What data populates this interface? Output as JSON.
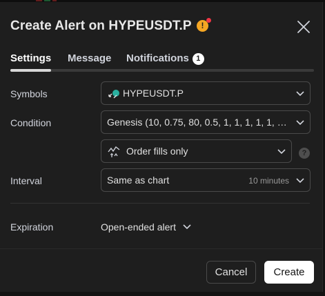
{
  "dialog": {
    "title": "Create Alert on HYPEUSDT.P",
    "warning_icon": "!"
  },
  "tabs": [
    {
      "label": "Settings",
      "active": true
    },
    {
      "label": "Message",
      "active": false
    },
    {
      "label": "Notifications",
      "active": false,
      "badge": "1"
    }
  ],
  "form": {
    "symbols": {
      "label": "Symbols",
      "value": "HYPEUSDT.P",
      "icon": "alert-symbol-icon"
    },
    "condition": {
      "label": "Condition",
      "value": "Genesis (10, 0.75, 80, 0.5, 1, 1, 1, 1, 1, …"
    },
    "trigger": {
      "value": "Order fills only",
      "icon": "order-fills-icon",
      "help": "?"
    },
    "interval": {
      "label": "Interval",
      "value": "Same as chart",
      "hint": "10 minutes"
    },
    "expiration": {
      "label": "Expiration",
      "value": "Open-ended alert"
    }
  },
  "footer": {
    "cancel_label": "Cancel",
    "create_label": "Create"
  }
}
